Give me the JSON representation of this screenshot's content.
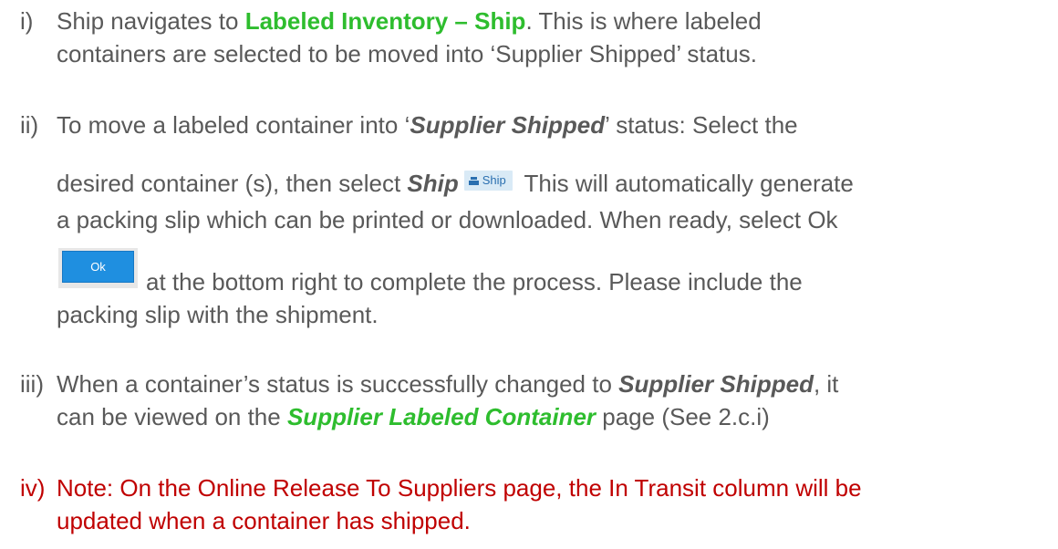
{
  "items": [
    {
      "num": "i)",
      "lines": [
        {
          "t1": "Ship navigates to ",
          "link": "Labeled Inventory – Ship",
          "t2": ". This is where labeled"
        },
        {
          "t1": "containers are selected to be moved into ‘Supplier Shipped’ status."
        }
      ]
    },
    {
      "num": "ii)",
      "l1a": "To move a labeled container into ‘",
      "l1b": "Supplier Shipped",
      "l1c": "’ status: Select the",
      "l2a": "desired container (s), then select ",
      "l2b": "Ship",
      "ship_button": "Ship",
      "l2c": " This will automatically generate",
      "l3": "a packing slip which can be printed or downloaded. When ready, select Ok",
      "ok_button": "Ok",
      "l4": "at the bottom right to complete the process. Please include the",
      "l5": "packing slip with the shipment."
    },
    {
      "num": "iii)",
      "l1a": "When a container’s status is successfully changed to ",
      "l1b": "Supplier Shipped",
      "l1c": ", it",
      "l2a": "can be viewed on the ",
      "l2b": "Supplier Labeled Container",
      "l2c": " page (See 2.c.i)"
    },
    {
      "num": "iv)",
      "l1": "Note: On the Online Release To Suppliers page, the In Transit column will be",
      "l2": "updated when a container has shipped."
    }
  ],
  "colors": {
    "body_text": "#595959",
    "link_green": "#2ebd2e",
    "note_red": "#c00000",
    "ok_blue": "#1f8fe0"
  }
}
